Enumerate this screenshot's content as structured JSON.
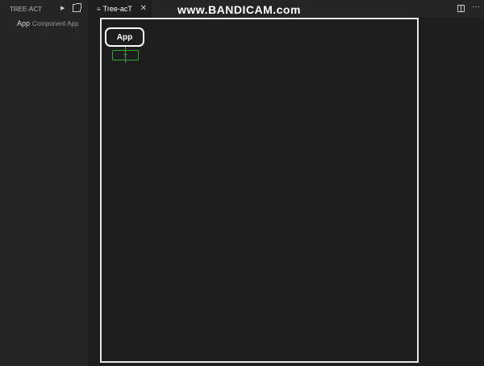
{
  "sidebar": {
    "title": "TREE-ACT",
    "run_icon": "play-icon",
    "open_icon": "open-external-icon",
    "items": [
      {
        "name": "App",
        "description": "Component App"
      }
    ]
  },
  "tabs": [
    {
      "label": "Tree-acT",
      "icon": "lines-icon",
      "close": "✕"
    }
  ],
  "watermark": "www.BANDICAM.com",
  "toolbar": {
    "split_icon": "split-editor-icon",
    "more": "···"
  },
  "canvas": {
    "root_node": "App",
    "add_label": "+",
    "add_color": "#2eaa2e"
  }
}
